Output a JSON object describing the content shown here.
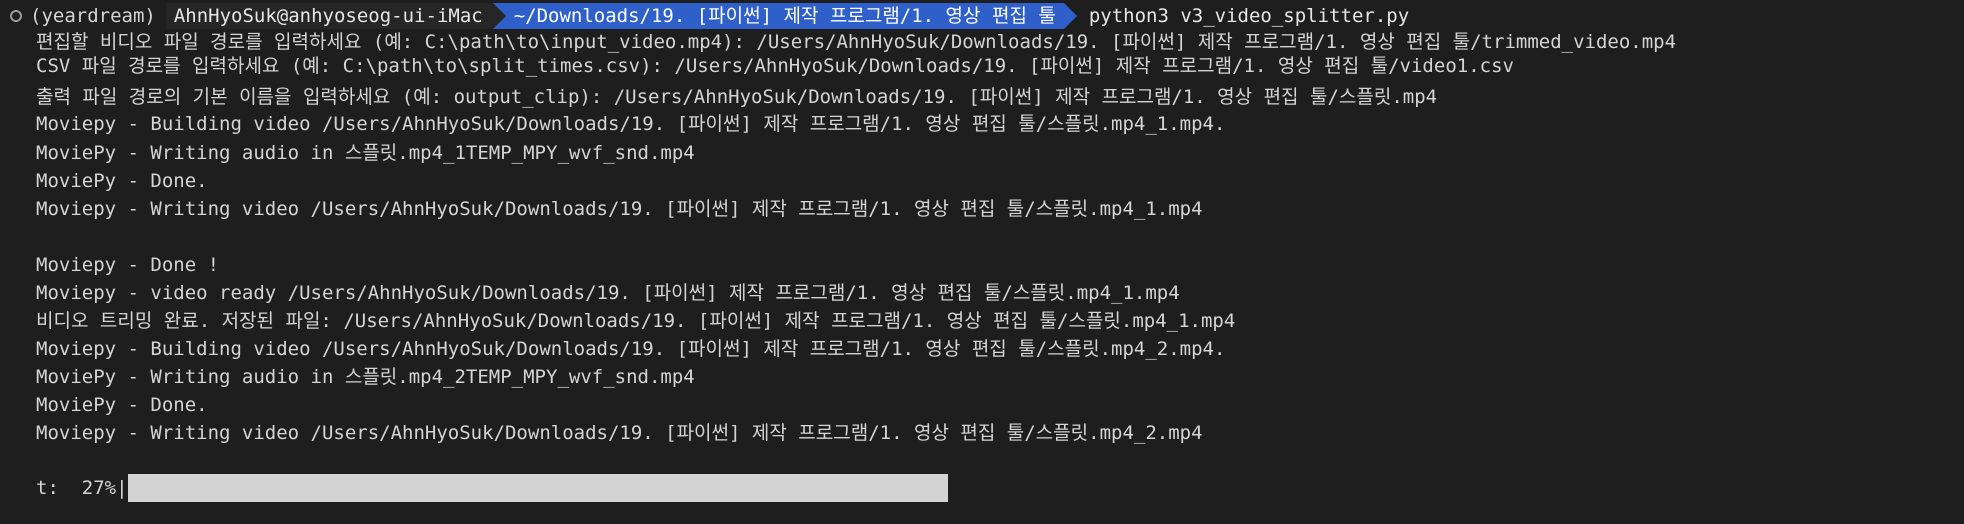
{
  "prompt": {
    "env": "(yeardream)",
    "user_host": "AhnHyoSuk@anhyoseog-ui-iMac",
    "path": "~/Downloads/19. [파이썬] 제작 프로그램/1. 영상 편집 툴",
    "command": "python3 v3_video_splitter.py"
  },
  "output_lines": [
    "편집할 비디오 파일 경로를 입력하세요 (예: C:\\path\\to\\input_video.mp4): /Users/AhnHyoSuk/Downloads/19. [파이썬] 제작 프로그램/1. 영상 편집 툴/trimmed_video.mp4",
    "CSV 파일 경로를 입력하세요 (예: C:\\path\\to\\split_times.csv): /Users/AhnHyoSuk/Downloads/19. [파이썬] 제작 프로그램/1. 영상 편집 툴/video1.csv",
    "출력 파일 경로의 기본 이름을 입력하세요 (예: output_clip): /Users/AhnHyoSuk/Downloads/19. [파이썬] 제작 프로그램/1. 영상 편집 툴/스플릿.mp4",
    "Moviepy - Building video /Users/AhnHyoSuk/Downloads/19. [파이썬] 제작 프로그램/1. 영상 편집 툴/스플릿.mp4_1.mp4.",
    "MoviePy - Writing audio in 스플릿.mp4_1TEMP_MPY_wvf_snd.mp4",
    "MoviePy - Done.",
    "Moviepy - Writing video /Users/AhnHyoSuk/Downloads/19. [파이썬] 제작 프로그램/1. 영상 편집 툴/스플릿.mp4_1.mp4",
    "",
    "Moviepy - Done !",
    "Moviepy - video ready /Users/AhnHyoSuk/Downloads/19. [파이썬] 제작 프로그램/1. 영상 편집 툴/스플릿.mp4_1.mp4",
    "비디오 트리밍 완료. 저장된 파일: /Users/AhnHyoSuk/Downloads/19. [파이썬] 제작 프로그램/1. 영상 편집 툴/스플릿.mp4_1.mp4",
    "Moviepy - Building video /Users/AhnHyoSuk/Downloads/19. [파이썬] 제작 프로그램/1. 영상 편집 툴/스플릿.mp4_2.mp4.",
    "MoviePy - Writing audio in 스플릿.mp4_2TEMP_MPY_wvf_snd.mp4",
    "MoviePy - Done.",
    "Moviepy - Writing video /Users/AhnHyoSuk/Downloads/19. [파이썬] 제작 프로그램/1. 영상 편집 툴/스플릿.mp4_2.mp4",
    ""
  ],
  "progress": {
    "label": "t:  27%|",
    "fraction": 0.27
  }
}
